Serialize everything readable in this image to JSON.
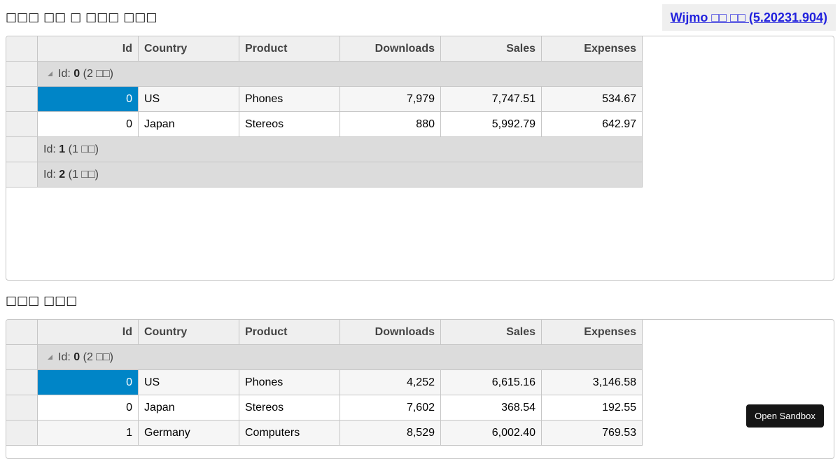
{
  "heading_top": "□□□ □□ □ □□□ □□□",
  "heading_bottom": "□□□ □□□",
  "version_link": "Wijmo □□ □□ (5.20231.904)",
  "sandbox_button": "Open Sandbox",
  "columns": {
    "id": "Id",
    "country": "Country",
    "product": "Product",
    "downloads": "Downloads",
    "sales": "Sales",
    "expenses": "Expenses"
  },
  "grid_top": {
    "groups": [
      {
        "label": "Id:",
        "key": "0",
        "count": "(2 □□)",
        "expanded": true,
        "rows": [
          {
            "id": "0",
            "country": "US",
            "product": "Phones",
            "downloads": "7,979",
            "sales": "7,747.51",
            "expenses": "534.67"
          },
          {
            "id": "0",
            "country": "Japan",
            "product": "Stereos",
            "downloads": "880",
            "sales": "5,992.79",
            "expenses": "642.97"
          }
        ]
      },
      {
        "label": "Id:",
        "key": "1",
        "count": "(1 □□)",
        "expanded": false
      },
      {
        "label": "Id:",
        "key": "2",
        "count": "(1 □□)",
        "expanded": false
      }
    ]
  },
  "grid_bottom": {
    "groups": [
      {
        "label": "Id:",
        "key": "0",
        "count": "(2 □□)",
        "expanded": true,
        "rows": [
          {
            "id": "0",
            "country": "US",
            "product": "Phones",
            "downloads": "4,252",
            "sales": "6,615.16",
            "expenses": "3,146.58"
          },
          {
            "id": "0",
            "country": "Japan",
            "product": "Stereos",
            "downloads": "7,602",
            "sales": "368.54",
            "expenses": "192.55"
          },
          {
            "id": "1",
            "country": "Germany",
            "product": "Computers",
            "downloads": "8,529",
            "sales": "6,002.40",
            "expenses": "769.53"
          }
        ]
      }
    ]
  },
  "colors": {
    "selection": "#0085c7",
    "group_bg": "#dcdcdc",
    "header_bg": "#efefef",
    "link": "#2222dd"
  }
}
